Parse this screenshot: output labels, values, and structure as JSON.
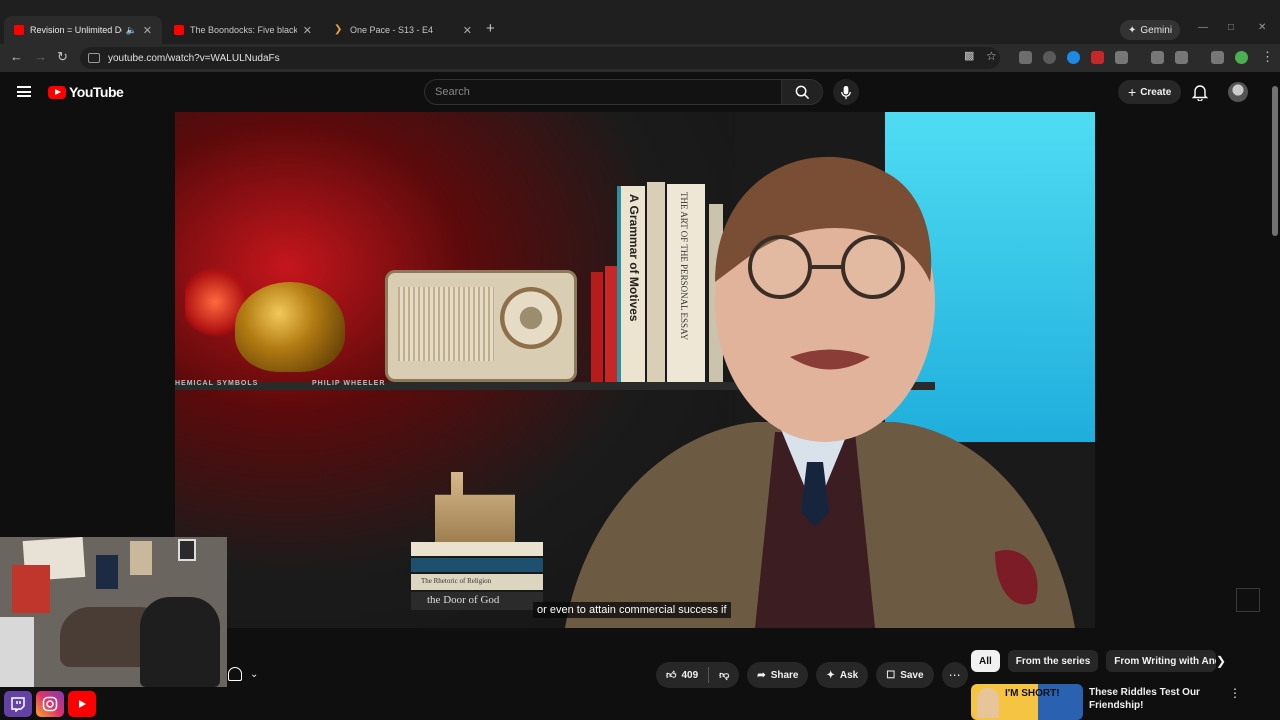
{
  "browser": {
    "tabs": [
      {
        "title": "Revision = Unlimited Do-O",
        "favicon": "youtube-icon",
        "color": "#ff0000",
        "active": true
      },
      {
        "title": "The Boondocks: Five black Mi",
        "favicon": "youtube-icon",
        "color": "#ff0000",
        "active": false
      },
      {
        "title": "One Pace - S13 - E4",
        "favicon": "chevron-icon",
        "color": "#e8a33d",
        "active": false
      }
    ],
    "gemini_label": "Gemini",
    "url": "youtube.com/watch?v=WALULNudaFs"
  },
  "youtube": {
    "logo_text": "YouTube",
    "search_placeholder": "Search",
    "create_label": "Create"
  },
  "video": {
    "subtitle": "or even to attain commercial success if",
    "shelf_label_left": "HEMICAL SYMBOLS",
    "shelf_label_right": "PHILIP WHEELER",
    "book_titles": [
      "A Grammar of Motives",
      "THE ART OF THE PERSONAL ESSAY",
      "the Door of God",
      "The Rhetoric of Religion"
    ]
  },
  "actions": {
    "like_count": "409",
    "share_label": "Share",
    "ask_label": "Ask",
    "save_label": "Save"
  },
  "chips": [
    {
      "label": "All",
      "active": true
    },
    {
      "label": "From the series",
      "active": false
    },
    {
      "label": "From Writing with Andrew",
      "active": false
    }
  ],
  "recommendation": {
    "thumb_text": "I'M SHORT!",
    "title": "These Riddles Test Our Friendship!"
  },
  "colors": {
    "accent": "#ff0000",
    "background": "#0f0f0f",
    "chip_active": "#f1f1f1"
  }
}
